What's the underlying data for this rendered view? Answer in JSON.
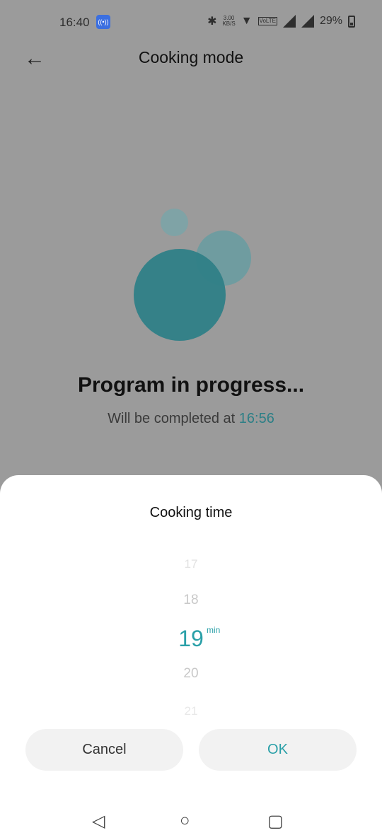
{
  "status": {
    "time": "16:40",
    "speed_top": "3.00",
    "speed_unit": "KB/S",
    "volte": "VoLTE",
    "battery": "29%"
  },
  "header": {
    "title": "Cooking mode"
  },
  "main": {
    "status_title": "Program in progress...",
    "completion_prefix": "Will be completed at",
    "completion_time": "16:56"
  },
  "sheet": {
    "title": "Cooking time",
    "picker": {
      "values": [
        "17",
        "18",
        "19",
        "20",
        "21"
      ],
      "selected": "19",
      "unit": "min"
    },
    "cancel": "Cancel",
    "ok": "OK"
  },
  "colors": {
    "accent": "#2aa0a8"
  }
}
